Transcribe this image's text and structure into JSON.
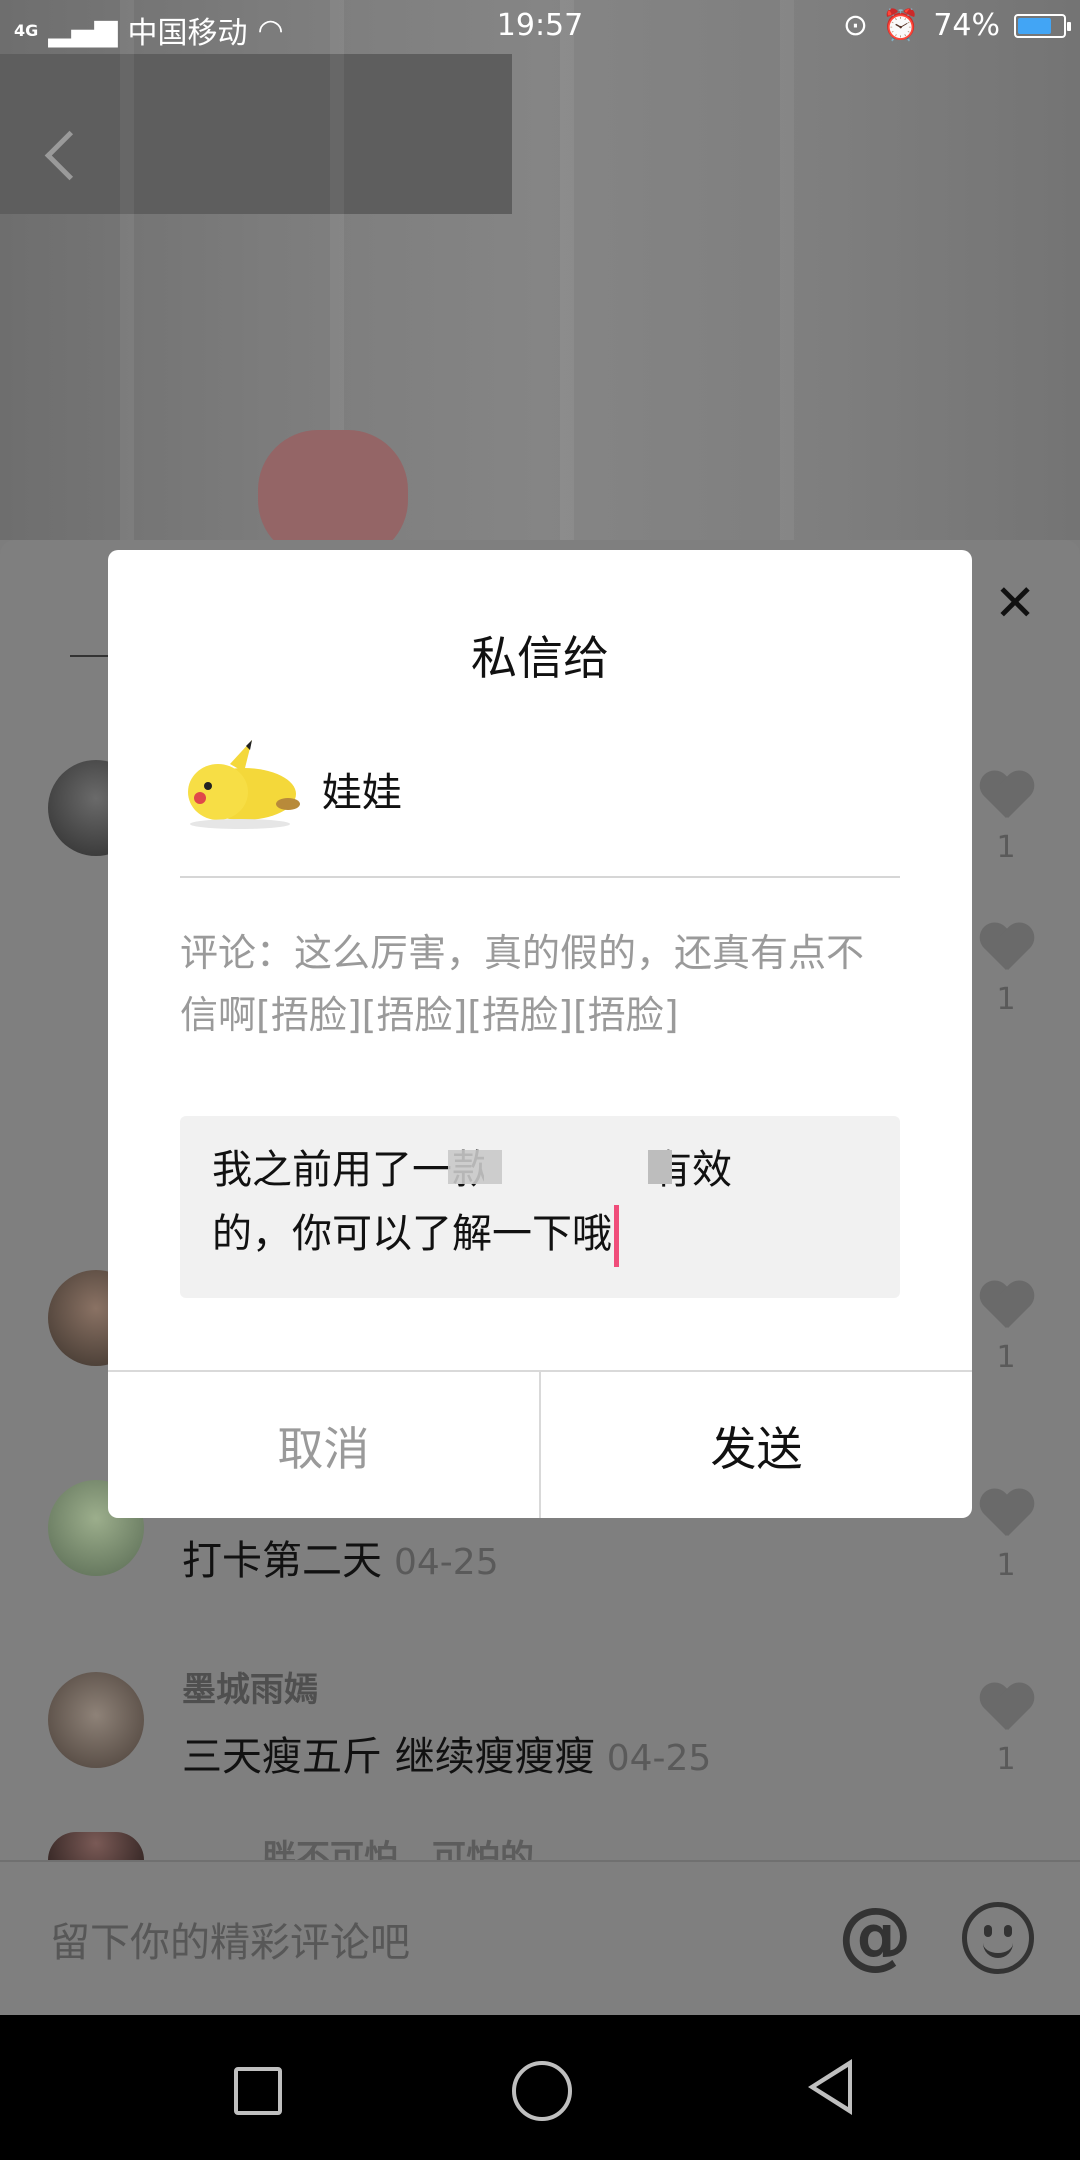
{
  "status_bar": {
    "network": "4G",
    "carrier": "中国移动",
    "time": "19:57",
    "battery_percent": "74%",
    "battery_level": 0.74
  },
  "comments": [
    {
      "username": "",
      "text": "",
      "date": "",
      "likes": "1"
    },
    {
      "username": "",
      "text": "",
      "date": "",
      "likes": "1"
    },
    {
      "username": "",
      "text": "",
      "date": "",
      "likes": "1"
    },
    {
      "username": "",
      "text": "打卡第二天",
      "date": "04-25",
      "likes": "1"
    },
    {
      "username": "墨城雨嫣",
      "text": "三天瘦五斤 继续瘦瘦瘦",
      "date": "04-25",
      "likes": "1"
    },
    {
      "username": "胖不可怕，可怕的",
      "text": "",
      "date": "",
      "likes": ""
    }
  ],
  "comment_input": {
    "placeholder": "留下你的精彩评论吧"
  },
  "dialog": {
    "title": "私信给",
    "recipient_name": "娃娃",
    "quoted_comment": "评论：这么厉害，真的假的，还真有点不信啊[捂脸][捂脸][捂脸][捂脸]",
    "message_line1_start": "我之前用了一款",
    "message_line1_end": "很有效",
    "message_line2": "的，你可以了解一下哦",
    "cancel_label": "取消",
    "send_label": "发送"
  },
  "colors": {
    "caret": "#f04d7a",
    "battery_fill": "#42a5f5"
  }
}
